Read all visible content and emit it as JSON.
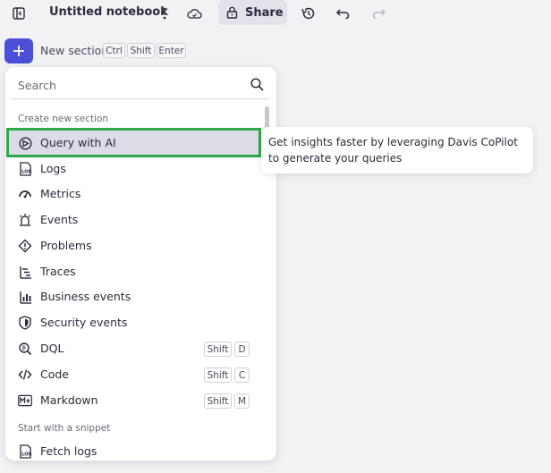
{
  "toolbar": {
    "title": "Untitled notebook",
    "share_label": "Share"
  },
  "new_section": {
    "label": "New section",
    "keys": [
      "Ctrl",
      "Shift",
      "Enter"
    ]
  },
  "menu": {
    "search_placeholder": "Search",
    "group_create": "Create new section",
    "items": [
      {
        "label": "Query with AI",
        "icon": "copilot-icon"
      },
      {
        "label": "Logs",
        "icon": "logs-icon"
      },
      {
        "label": "Metrics",
        "icon": "metrics-icon"
      },
      {
        "label": "Events",
        "icon": "events-icon"
      },
      {
        "label": "Problems",
        "icon": "problems-icon"
      },
      {
        "label": "Traces",
        "icon": "traces-icon"
      },
      {
        "label": "Business events",
        "icon": "business-events-icon"
      },
      {
        "label": "Security events",
        "icon": "shield-icon"
      },
      {
        "label": "DQL",
        "icon": "dql-icon",
        "keys": [
          "Shift",
          "D"
        ]
      },
      {
        "label": "Code",
        "icon": "code-icon",
        "keys": [
          "Shift",
          "C"
        ]
      },
      {
        "label": "Markdown",
        "icon": "markdown-icon",
        "keys": [
          "Shift",
          "M"
        ]
      }
    ],
    "group_snippet": "Start with a snippet",
    "snippet_items": [
      {
        "label": "Fetch logs",
        "icon": "logs-icon"
      }
    ]
  },
  "tooltip": {
    "text": "Get insights faster by leveraging Davis CoPilot to generate your queries"
  },
  "colors": {
    "accent": "#4b4fd7",
    "highlight_outline": "#2ea84a",
    "selected_bg": "#dcdce6"
  }
}
